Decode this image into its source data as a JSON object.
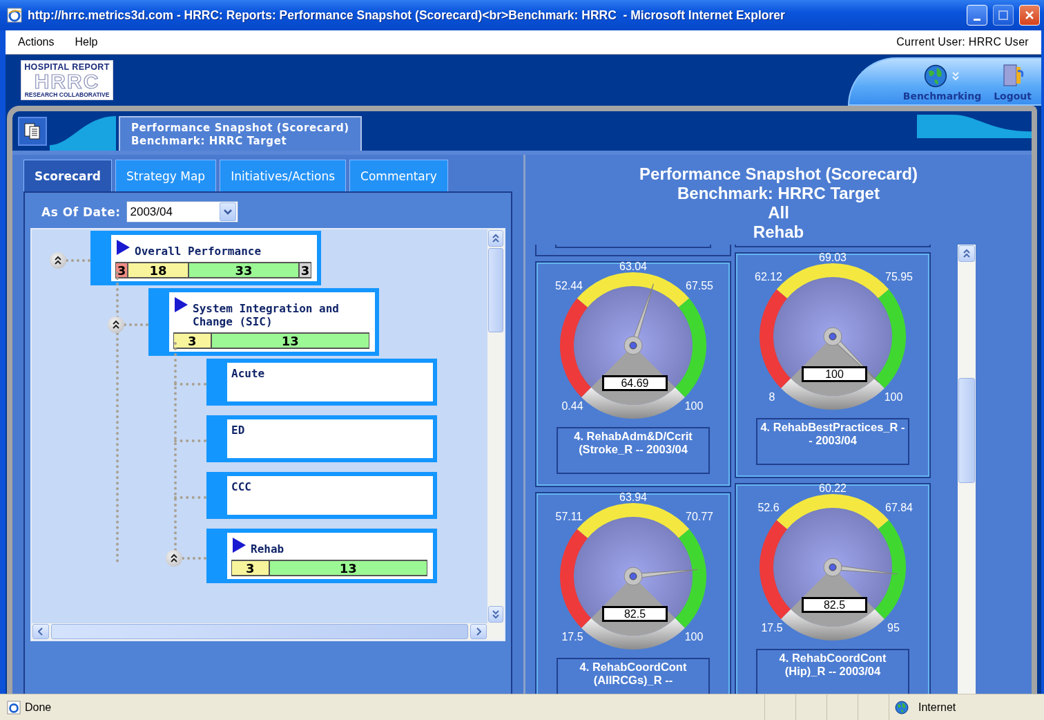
{
  "window": {
    "title": "http://hrrc.metrics3d.com - HRRC: Reports: Performance Snapshot (Scorecard)<br>Benchmark: HRRC  - Microsoft Internet Explorer"
  },
  "menu": [
    "Actions",
    "Help"
  ],
  "current_user": "Current User: HRRC User",
  "logo": {
    "top": "HOSPITAL REPORT",
    "middle": "HRRC",
    "bottom": "RESEARCH COLLABORATIVE"
  },
  "header_buttons": [
    {
      "label": "Benchmarking",
      "kind": "globe"
    },
    {
      "label": "Logout",
      "kind": "door"
    }
  ],
  "page_title": {
    "line1": "Performance Snapshot (Scorecard)",
    "line2": "Benchmark: HRRC Target"
  },
  "tabs": [
    {
      "label": "Scorecard",
      "selected": true
    },
    {
      "label": "Strategy Map",
      "selected": false
    },
    {
      "label": "Initiatives/Actions",
      "selected": false
    },
    {
      "label": "Commentary",
      "selected": false
    }
  ],
  "as_of_date": {
    "label": "As Of Date:",
    "value": "2003/04"
  },
  "tree": [
    {
      "title": "Overall Performance",
      "expanded": true,
      "scores": [
        {
          "value": "3",
          "color": "#f08c84"
        },
        {
          "value": "18",
          "color": "#f8f49c"
        },
        {
          "value": "33",
          "color": "#9cf894"
        },
        {
          "value": "3",
          "color": "#d4d4d4"
        }
      ],
      "children": [
        {
          "title": "System Integration and Change (SIC)",
          "expanded": true,
          "scores": [
            {
              "value": "3",
              "color": "#f8f49c"
            },
            {
              "value": "13",
              "color": "#9cf894"
            }
          ],
          "children": [
            {
              "title": "Acute"
            },
            {
              "title": "ED"
            },
            {
              "title": "CCC"
            },
            {
              "title": "Rehab",
              "expanded": true,
              "scores": [
                {
                  "value": "3",
                  "color": "#f8f49c"
                },
                {
                  "value": "13",
                  "color": "#9cf894"
                }
              ]
            }
          ]
        }
      ]
    }
  ],
  "report": {
    "title_lines": [
      "Performance Snapshot (Scorecard)",
      "Benchmark: HRRC Target",
      "All",
      "Rehab"
    ]
  },
  "gauges": [
    {
      "mid": "63.04",
      "low": "52.44",
      "high": "67.55",
      "min": "0.44",
      "max": "100",
      "reading": "64.69",
      "caption": "4. RehabAdm&D/Ccrit (Stroke_R -- 2003/04"
    },
    {
      "mid": "69.03",
      "low": "62.12",
      "high": "75.95",
      "min": "8",
      "max": "100",
      "reading": "100",
      "caption": "4. RehabBestPractices_R -- 2003/04"
    },
    {
      "mid": "63.94",
      "low": "57.11",
      "high": "70.77",
      "min": "17.5",
      "max": "100",
      "reading": "82.5",
      "caption": "4. RehabCoordCont (AllRCGs)_R --"
    },
    {
      "mid": "60.22",
      "low": "52.6",
      "high": "67.84",
      "min": "17.5",
      "max": "95",
      "reading": "82.5",
      "caption": "4. RehabCoordCont (Hip)_R -- 2003/04"
    }
  ],
  "status_bar": {
    "text": "Done",
    "zone": "Internet"
  }
}
